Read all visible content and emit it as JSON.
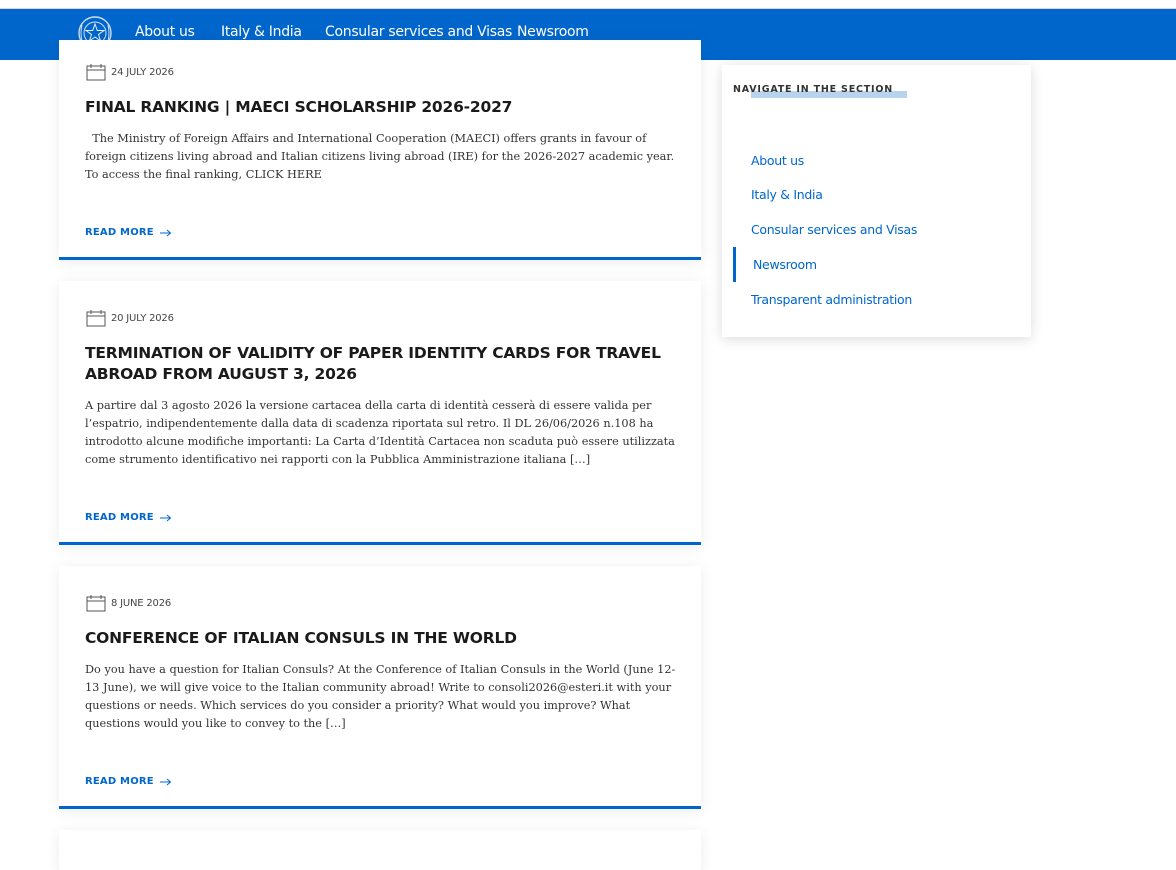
{
  "nav": {
    "items": [
      "About us",
      "Italy & India",
      "Consular services and Visas",
      "Newsroom"
    ]
  },
  "articles": [
    {
      "date": "24 JULY 2026",
      "title": "FINAL RANKING | MAECI SCHOLARSHIP 2026-2027",
      "text": "  The Ministry of Foreign Affairs and International Cooperation (MAECI) offers grants in favour of foreign citizens living abroad and Italian citizens living abroad (IRE) for the 2026-2027 academic year. To access the final ranking, CLICK HERE",
      "read_more": "READ MORE"
    },
    {
      "date": "20 JULY 2026",
      "title": "TERMINATION OF VALIDITY OF PAPER IDENTITY CARDS FOR TRAVEL ABROAD FROM AUGUST 3, 2026",
      "text": "A partire dal 3 agosto 2026 la versione cartacea della carta di identità cesserà di essere valida per l’espatrio, indipendentemente dalla data di scadenza riportata sul retro. Il DL 26/06/2026 n.108 ha introdotto alcune modifiche importanti: La Carta d’Identità Cartacea non scaduta può essere utilizzata come strumento identificativo nei rapporti con la Pubblica Amministrazione italiana […]",
      "read_more": "READ MORE"
    },
    {
      "date": "8 JUNE 2026",
      "title": "CONFERENCE OF ITALIAN CONSULS IN THE WORLD",
      "text": "Do you have a question for Italian Consuls? At the Conference of Italian Consuls in the World (June 12-13 June), we will give voice to the Italian community abroad! Write to consoli2026@esteri.it with your questions or needs. Which services do you consider a priority? What would you improve? What questions would you like to convey to the […]",
      "read_more": "READ MORE"
    }
  ],
  "sidebar": {
    "heading": "NAVIGATE IN THE SECTION",
    "items": [
      "About us",
      "Italy & India",
      "Consular services and Visas",
      "Newsroom",
      "Transparent administration"
    ],
    "active": "Newsroom"
  },
  "colors": {
    "brand_blue": "#0066cc",
    "highlight": "#b7d3ee"
  },
  "icons": {
    "emblem": "italian-republic-emblem",
    "date": "calendar-icon",
    "read_more": "arrow-right-icon"
  }
}
